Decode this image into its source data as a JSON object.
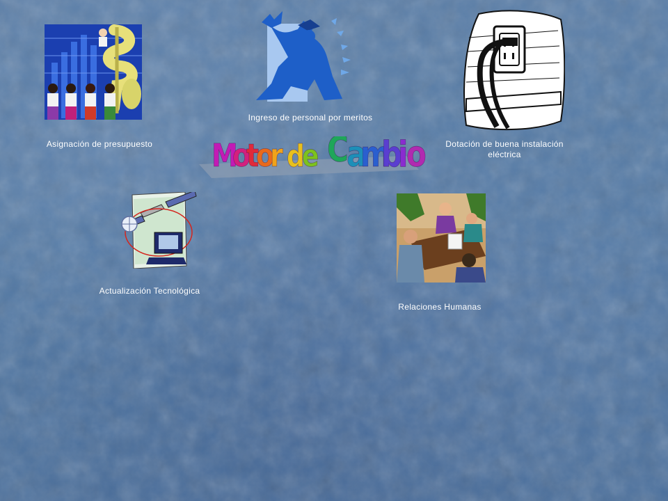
{
  "title": {
    "words": [
      {
        "text": "Motor",
        "letters": [
          "M",
          "o",
          "t",
          "o",
          "r"
        ]
      },
      {
        "text": "de",
        "letters": [
          "d",
          "e"
        ]
      },
      {
        "text": "Cambio",
        "letters": [
          "C",
          "a",
          "m",
          "b",
          "i",
          "o"
        ]
      }
    ],
    "letter_colors": [
      "#c21bb5",
      "#d3207e",
      "#e02a3a",
      "#e86a1c",
      "#f0a31a",
      "#e8c01c",
      "#7cc21e",
      "#1fa65a",
      "#1d8fb8",
      "#2a5fcf",
      "#5a3ed0",
      "#8a2ccf",
      "#b12ab0"
    ]
  },
  "items": {
    "budget": {
      "caption": "Asignación de presupuesto",
      "icon": "money-growth-clipart"
    },
    "merit": {
      "caption": "Ingreso de personal por meritos",
      "icon": "graduate-clipart"
    },
    "electric": {
      "caption": "Dotación de buena instalación eléctrica",
      "icon": "power-outlet-clipart"
    },
    "tech": {
      "caption": "Actualización Tecnológica",
      "icon": "satellite-computer-clipart"
    },
    "relations": {
      "caption": "Relaciones Humanas",
      "icon": "business-meeting-clipart"
    }
  },
  "colors": {
    "background": "#5078a4",
    "caption_text": "#ffffff"
  }
}
